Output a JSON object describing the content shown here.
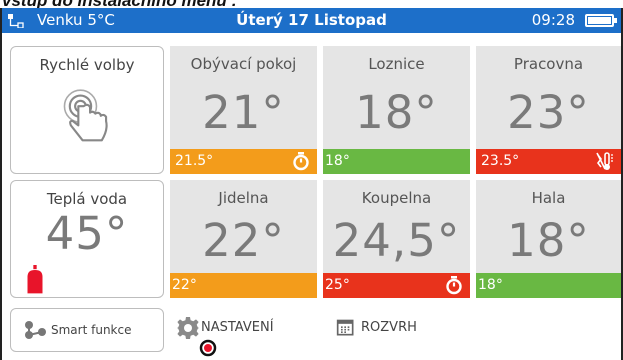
{
  "caption": "vstup do instalačního menu :",
  "status": {
    "weather": "Venku   5°C",
    "date": "Úterý 17 Listopad",
    "time": "09:28"
  },
  "quick": {
    "label": "Rychlé volby"
  },
  "water": {
    "label": "Teplá voda",
    "temp": "45°"
  },
  "rooms": [
    {
      "name": "Obývací pokoj",
      "temp": "21°",
      "setpoint": "21.5°",
      "state": "heating",
      "icon": "stopwatch-icon"
    },
    {
      "name": "Loznice",
      "temp": "18°",
      "setpoint": "18°",
      "state": "ok",
      "icon": ""
    },
    {
      "name": "Pracovna",
      "temp": "23°",
      "setpoint": "23.5°",
      "state": "cooling",
      "icon": "no-heating-icon"
    },
    {
      "name": "Jidelna",
      "temp": "22°",
      "setpoint": "22°",
      "state": "heating",
      "icon": ""
    },
    {
      "name": "Koupelna",
      "temp": "24,5°",
      "setpoint": "25°",
      "state": "alert",
      "icon": "stopwatch-icon"
    },
    {
      "name": "Hala",
      "temp": "18°",
      "setpoint": "18°",
      "state": "ok",
      "icon": ""
    }
  ],
  "bottom": {
    "smart": "Smart funkce",
    "settings": "NASTAVENÍ",
    "schedule": "ROZVRH"
  },
  "colors": {
    "statusbar": "#1d6fc9",
    "heating": "#f39c1b",
    "ok": "#69b843",
    "alert": "#e8331c"
  }
}
